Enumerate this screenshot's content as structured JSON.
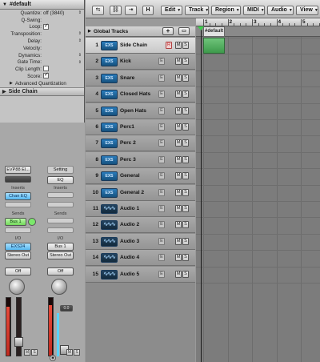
{
  "region": {
    "title": "#default",
    "params": [
      {
        "label": "Quantize:",
        "value": "off (3840)",
        "kind": "select"
      },
      {
        "label": "Q-Swing:",
        "value": "",
        "kind": "text"
      },
      {
        "label": "Loop:",
        "value": "",
        "kind": "checkbox",
        "checked": true
      },
      {
        "label": "Transposition:",
        "value": "",
        "kind": "select"
      },
      {
        "label": "Delay:",
        "value": "",
        "kind": "select"
      },
      {
        "label": "Velocity:",
        "value": "",
        "kind": "text"
      },
      {
        "label": "Dynamics:",
        "value": "",
        "kind": "select"
      },
      {
        "label": "Gate Time:",
        "value": "",
        "kind": "select"
      },
      {
        "label": "Clip Length:",
        "value": "",
        "kind": "checkbox",
        "checked": false
      },
      {
        "label": "Score:",
        "value": "",
        "kind": "checkbox",
        "checked": true
      }
    ],
    "advanced_label": "Advanced Quantization"
  },
  "track_inspector": {
    "title": "Side Chain"
  },
  "channel_strips": {
    "left": {
      "setting": "EVP88 El...",
      "inserts_label": "Inserts",
      "insert1": "Chan EQ",
      "sends_label": "Sends",
      "send1": "Bus 1",
      "io_label": "I/O",
      "input": "EXS24",
      "output": "Stereo Out",
      "automation": "Off",
      "mute": "M",
      "solo": "S",
      "meter_level": 0.85
    },
    "right": {
      "setting": "Setting",
      "eq": "EQ",
      "inserts_label": "Inserts",
      "sends_label": "Sends",
      "io_label": "I/O",
      "input": "Bus 1",
      "output": "Stereo Out",
      "automation": "Off",
      "volume_readout": "0.0",
      "mute": "M",
      "solo": "S",
      "meter_level": 0.88
    }
  },
  "toolbar": {
    "edit": "Edit",
    "track": "Track",
    "region": "Region",
    "midi": "MIDI",
    "audio": "Audio",
    "view": "View",
    "h_button": "H"
  },
  "global_tracks": {
    "label": "Global Tracks"
  },
  "tracks": [
    {
      "num": "1",
      "name": "Side Chain",
      "type": "EXS"
    },
    {
      "num": "2",
      "name": "Kick",
      "type": "EXS"
    },
    {
      "num": "3",
      "name": "Snare",
      "type": "EXS"
    },
    {
      "num": "4",
      "name": "Closed Hats",
      "type": "EXS"
    },
    {
      "num": "5",
      "name": "Open Hats",
      "type": "EXS"
    },
    {
      "num": "6",
      "name": "Perc1",
      "type": "EXS"
    },
    {
      "num": "7",
      "name": "Perc 2",
      "type": "EXS"
    },
    {
      "num": "8",
      "name": "Perc 3",
      "type": "EXS"
    },
    {
      "num": "9",
      "name": "General",
      "type": "EXS"
    },
    {
      "num": "10",
      "name": "General 2",
      "type": "EXS"
    },
    {
      "num": "11",
      "name": "Audio 1",
      "type": "audio"
    },
    {
      "num": "12",
      "name": "Audio 2",
      "type": "audio"
    },
    {
      "num": "13",
      "name": "Audio 3",
      "type": "audio"
    },
    {
      "num": "14",
      "name": "Audio 4",
      "type": "audio"
    },
    {
      "num": "15",
      "name": "Audio 5",
      "type": "audio"
    }
  ],
  "ruler": {
    "bars": [
      "1",
      "2",
      "3",
      "4",
      "5"
    ]
  },
  "arrange": {
    "marker": "#default"
  },
  "colors": {
    "region": "#4fae5c",
    "selected_track": "#dadada",
    "send_green": "#72d85a",
    "insert_blue": "#56b8ef"
  }
}
